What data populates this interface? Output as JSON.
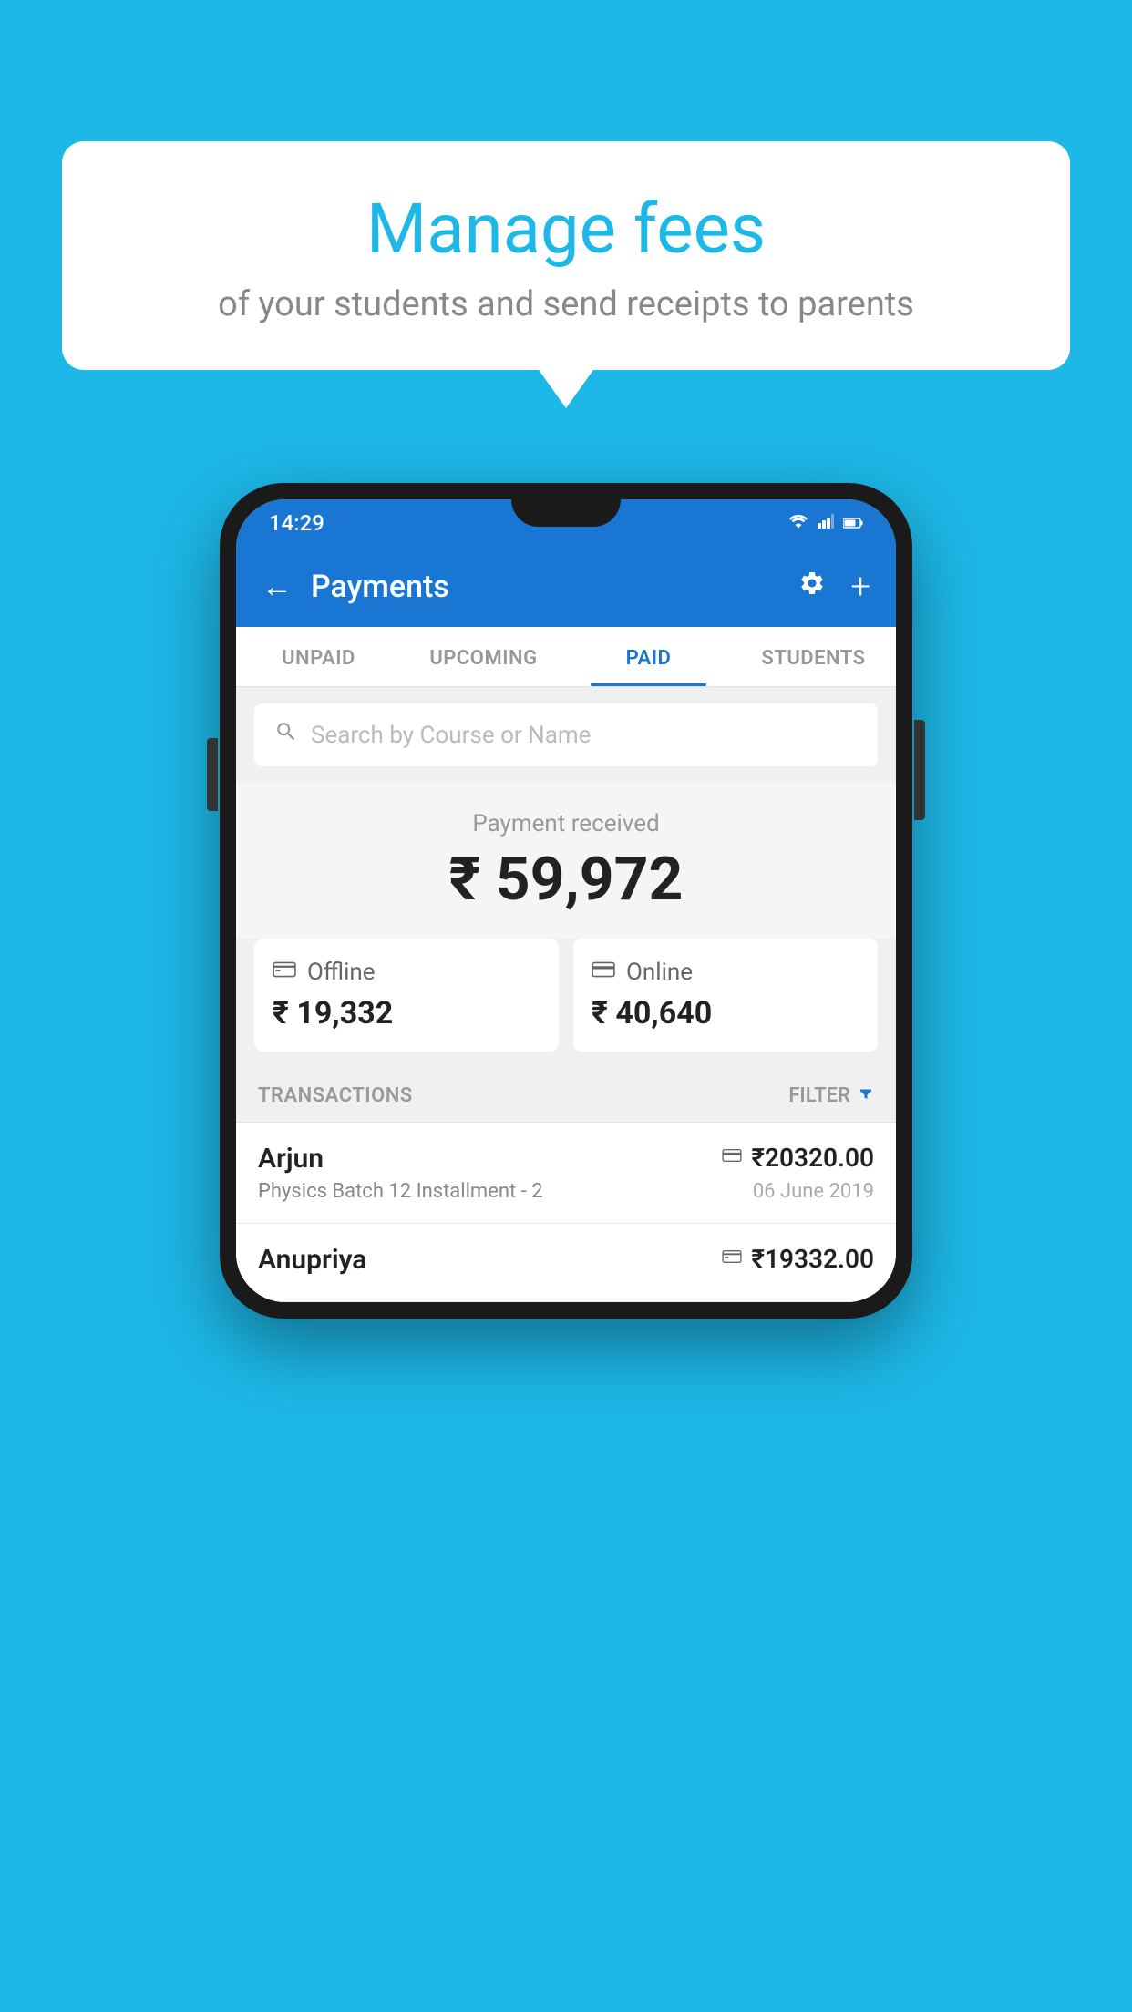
{
  "background_color": "#1DB8E8",
  "bubble": {
    "title": "Manage fees",
    "subtitle": "of your students and send receipts to parents"
  },
  "status_bar": {
    "time": "14:29",
    "wifi": "▾",
    "signal": "▲",
    "battery": "▮"
  },
  "app_bar": {
    "title": "Payments",
    "back_icon": "←",
    "settings_icon": "⚙",
    "add_icon": "+"
  },
  "tabs": [
    {
      "label": "UNPAID",
      "active": false
    },
    {
      "label": "UPCOMING",
      "active": false
    },
    {
      "label": "PAID",
      "active": true
    },
    {
      "label": "STUDENTS",
      "active": false
    }
  ],
  "search": {
    "placeholder": "Search by Course or Name"
  },
  "payment_received": {
    "label": "Payment received",
    "amount": "₹ 59,972"
  },
  "payment_cards": [
    {
      "type": "Offline",
      "icon": "🪙",
      "amount": "₹ 19,332"
    },
    {
      "type": "Online",
      "icon": "💳",
      "amount": "₹ 40,640"
    }
  ],
  "transactions_header": {
    "label": "TRANSACTIONS",
    "filter_label": "FILTER"
  },
  "transactions": [
    {
      "name": "Arjun",
      "course": "Physics Batch 12 Installment - 2",
      "amount": "₹20320.00",
      "date": "06 June 2019",
      "type_icon": "card"
    },
    {
      "name": "Anupriya",
      "course": "",
      "amount": "₹19332.00",
      "date": "",
      "type_icon": "cash"
    }
  ]
}
